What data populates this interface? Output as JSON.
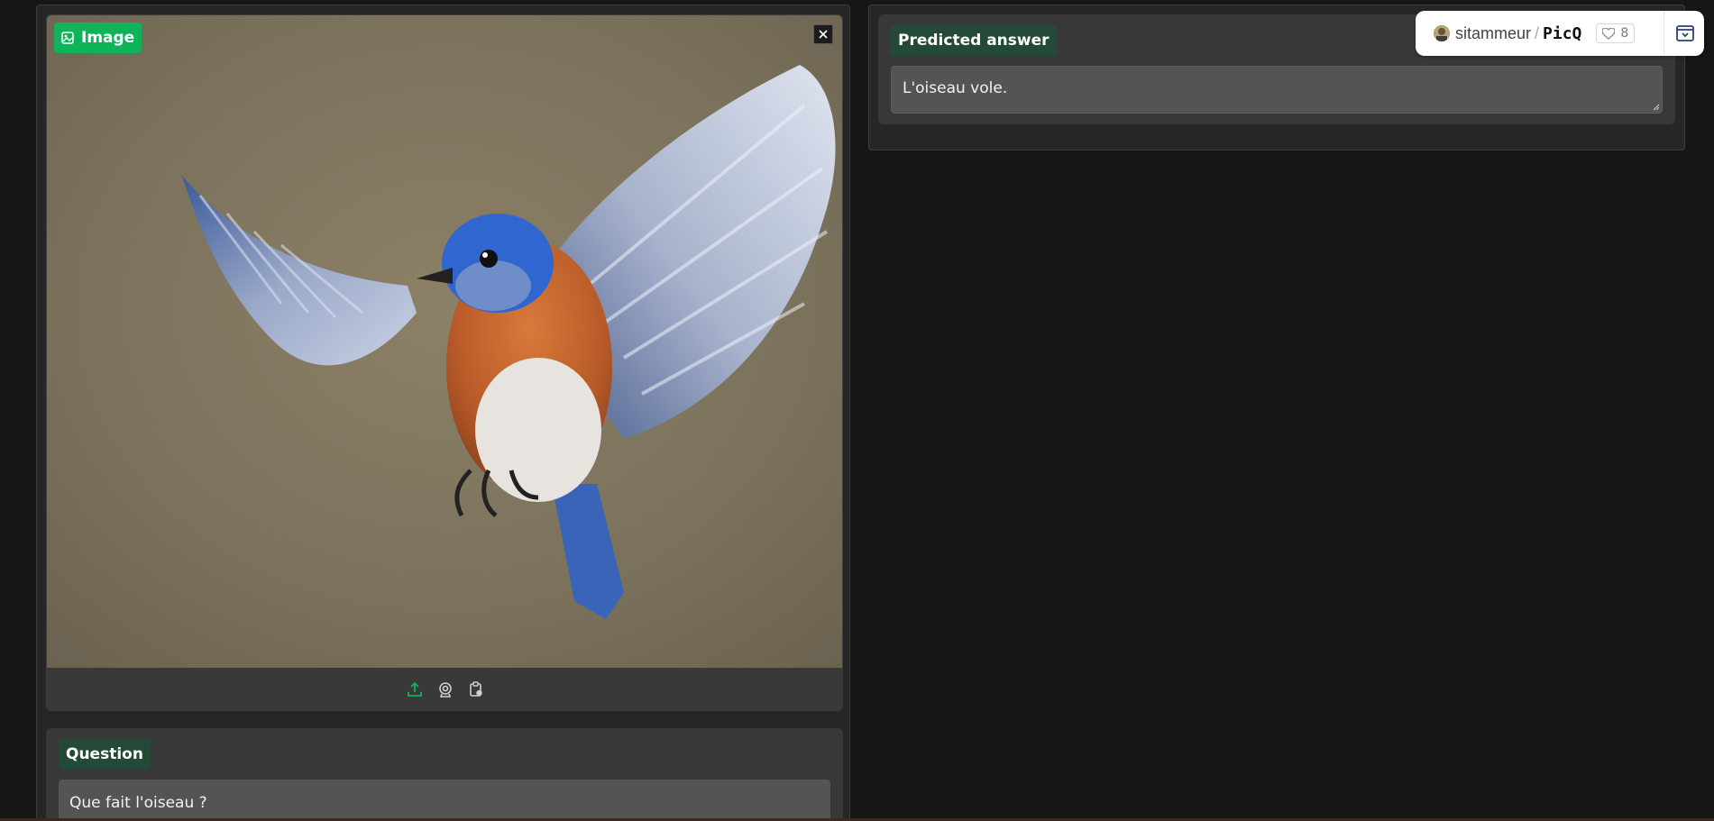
{
  "image_input": {
    "label": "Image",
    "clear_tooltip": "Clear",
    "sources": [
      "upload-icon",
      "webcam-icon",
      "clipboard-icon"
    ]
  },
  "question": {
    "label": "Question",
    "value": "Que fait l'oiseau ?"
  },
  "answer": {
    "label": "Predicted answer",
    "value": "L'oiseau vole."
  },
  "space_header": {
    "owner": "sitammeur",
    "separator": "/",
    "repo": "PicQ",
    "likes": "8"
  },
  "colors": {
    "accent_green": "#0fb45a",
    "dark_green_label": "#234a37",
    "background": "#161616",
    "panel": "#262626"
  }
}
